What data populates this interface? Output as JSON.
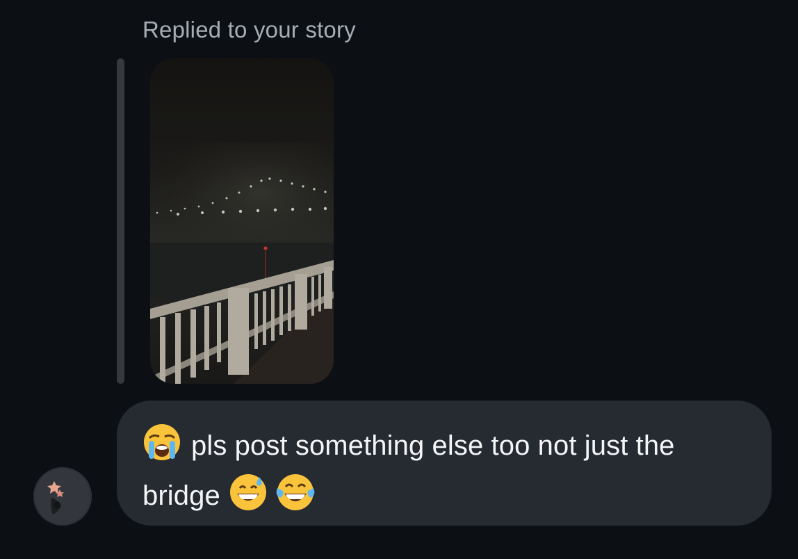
{
  "thread": {
    "reply_caption": "Replied to your story",
    "story": {
      "thumbnail_icon": "story-photo-foggy-bridge-night"
    },
    "message": {
      "leading_emoji_icon": "loudly-crying-face-icon",
      "text": "pls post something else too not just the bridge",
      "trailing_emoji_icons": [
        "grinning-face-with-sweat-icon",
        "face-with-tears-of-joy-icon"
      ]
    },
    "sender": {
      "avatar_icon": "avatar-icon"
    }
  },
  "colors": {
    "background": "#0c1014",
    "bubble": "#262a31",
    "quote_bar": "#363a3f",
    "caption_text": "#a8adb4",
    "message_text": "#f4f5f7"
  }
}
